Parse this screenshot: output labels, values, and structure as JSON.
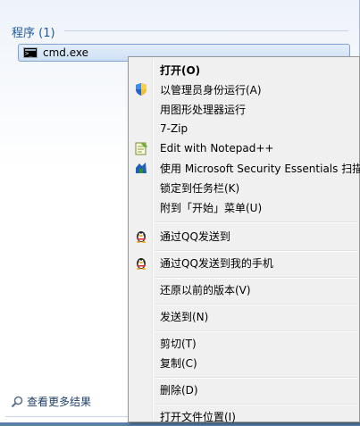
{
  "programs_header": "程序 (1)",
  "result": {
    "label": "cmd.exe",
    "icon": "cmd-icon"
  },
  "see_more": "查看更多结果",
  "menu": {
    "items": [
      {
        "label": "打开(O)",
        "icon": "",
        "bold": true
      },
      {
        "label": "以管理员身份运行(A)",
        "icon": "uac-shield-icon"
      },
      {
        "label": "用图形处理器运行",
        "icon": ""
      },
      {
        "label": "7-Zip",
        "icon": ""
      },
      {
        "label": "Edit with Notepad++",
        "icon": "notepad-plus-plus-icon"
      },
      {
        "label": "使用 Microsoft Security Essentials 扫描...",
        "icon": "mse-icon"
      },
      {
        "label": "锁定到任务栏(K)",
        "icon": ""
      },
      {
        "label": "附到「开始」菜单(U)",
        "icon": ""
      },
      {
        "label": "通过QQ发送到",
        "icon": "qq-penguin-icon"
      },
      {
        "label": "通过QQ发送到我的手机",
        "icon": "qq-penguin-icon"
      },
      {
        "label": "还原以前的版本(V)",
        "icon": ""
      },
      {
        "label": "发送到(N)",
        "icon": ""
      },
      {
        "label": "剪切(T)",
        "icon": ""
      },
      {
        "label": "复制(C)",
        "icon": ""
      },
      {
        "label": "删除(D)",
        "icon": ""
      },
      {
        "label": "打开文件位置(I)",
        "icon": ""
      }
    ]
  }
}
